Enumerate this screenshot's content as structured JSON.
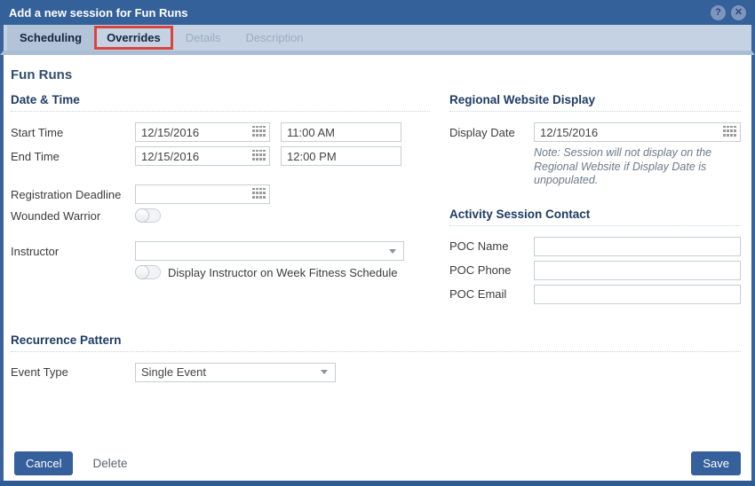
{
  "dialog": {
    "title": "Add a new session for Fun Runs",
    "help_icon": "?",
    "close_icon": "✕"
  },
  "tabs": [
    {
      "label": "Scheduling",
      "state": "active"
    },
    {
      "label": "Overrides",
      "state": "annotated"
    },
    {
      "label": "Details",
      "state": "disabled"
    },
    {
      "label": "Description",
      "state": "disabled"
    }
  ],
  "content": {
    "heading": "Fun Runs",
    "date_time": {
      "section_title": "Date & Time",
      "start_time": {
        "label": "Start Time",
        "date": "12/15/2016",
        "time": "11:00 AM"
      },
      "end_time": {
        "label": "End Time",
        "date": "12/15/2016",
        "time": "12:00 PM"
      },
      "registration_deadline": {
        "label": "Registration Deadline",
        "date": ""
      },
      "wounded_warrior": {
        "label": "Wounded Warrior",
        "value": "off"
      },
      "instructor": {
        "label": "Instructor",
        "value": ""
      },
      "display_instructor": {
        "label": "Display Instructor on Week Fitness Schedule",
        "value": "off"
      }
    },
    "regional": {
      "section_title": "Regional Website Display",
      "display_date": {
        "label": "Display Date",
        "date": "12/15/2016"
      },
      "note": "Note: Session will not display on the Regional Website if Display Date is unpopulated."
    },
    "contact": {
      "section_title": "Activity Session Contact",
      "poc_name": {
        "label": "POC Name",
        "value": ""
      },
      "poc_phone": {
        "label": "POC Phone",
        "value": ""
      },
      "poc_email": {
        "label": "POC Email",
        "value": ""
      }
    },
    "recurrence": {
      "section_title": "Recurrence Pattern",
      "event_type": {
        "label": "Event Type",
        "value": "Single Event"
      }
    }
  },
  "footer": {
    "cancel_label": "Cancel",
    "delete_label": "Delete",
    "save_label": "Save"
  },
  "colors": {
    "titlebar_blue": "#34619A",
    "tabbar_blue": "#C4D2E4",
    "active_tab_blue": "#B4C4D8",
    "annotation_red": "#D9453C",
    "heading_navy": "#1E3C64",
    "button_blue": "#35609B"
  }
}
